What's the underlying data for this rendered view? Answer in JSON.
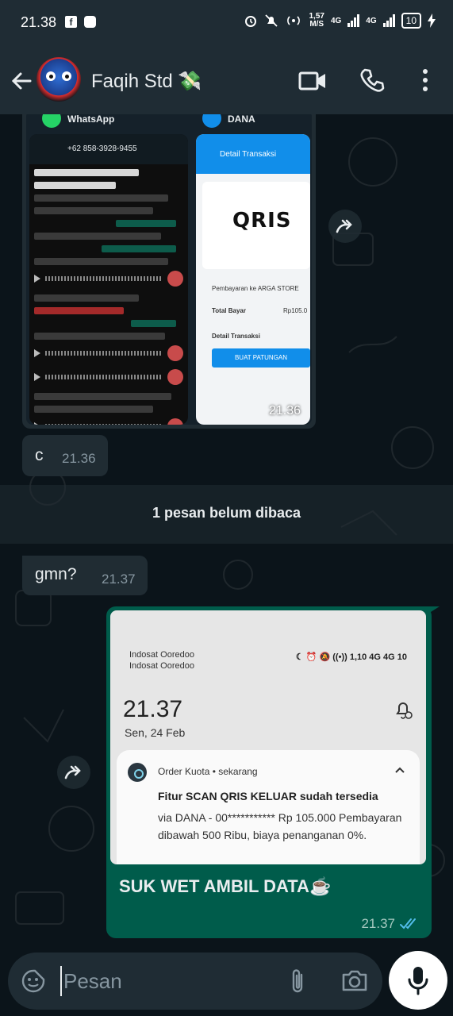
{
  "status_bar": {
    "time": "21.38",
    "speed_value": "1,57",
    "speed_unit": "M/S",
    "network_1": "4G",
    "network_2": "4G",
    "battery": "10"
  },
  "header": {
    "contact_name": "Faqih Std 💸"
  },
  "messages": {
    "image_msg": {
      "time": "21.36",
      "left_label": "WhatsApp",
      "left_number": "+62 858-3928-9455",
      "right_label": "DANA",
      "right_title": "Detail Transaksi",
      "qris": "QRIS",
      "merchant": "Pembayaran ke ARGA STORE",
      "total_label": "Total Bayar",
      "total_value": "Rp105.0",
      "detail_label": "Detail Transaksi",
      "button": "BUAT PATUNGAN"
    },
    "c_msg": {
      "text": "c",
      "time": "21.36"
    },
    "unread_banner": "1 pesan belum dibaca",
    "gmn_msg": {
      "text": "gmn?",
      "time": "21.37"
    },
    "outgoing": {
      "carrier_1": "Indosat Ooredoo",
      "carrier_2": "Indosat Ooredoo",
      "lock_icons": "☾ ⏰ 🔕 ((•)) 1,10 4G 4G 10",
      "lock_time": "21.37",
      "lock_date": "Sen, 24 Feb",
      "notif_app": "Order Kuota • sekarang",
      "notif_title": "Fitur SCAN QRIS KELUAR sudah tersedia",
      "notif_body": "via DANA - 00*********** Rp 105.000 Pembayaran dibawah 500 Ribu, biaya penanganan 0%.",
      "caption": "SUK WET AMBIL DATA☕",
      "time": "21.37"
    }
  },
  "input": {
    "placeholder": "Pesan"
  },
  "colors": {
    "background": "#0b141a",
    "header": "#1f2c34",
    "incoming_bubble": "#202c33",
    "outgoing_bubble": "#005c4b",
    "read_ticks": "#53bdeb"
  },
  "icons": [
    "back-arrow-icon",
    "video-call-icon",
    "phone-icon",
    "more-vert-icon",
    "forward-icon",
    "sticker-icon",
    "attach-icon",
    "camera-icon",
    "mic-icon",
    "double-check-icon"
  ]
}
